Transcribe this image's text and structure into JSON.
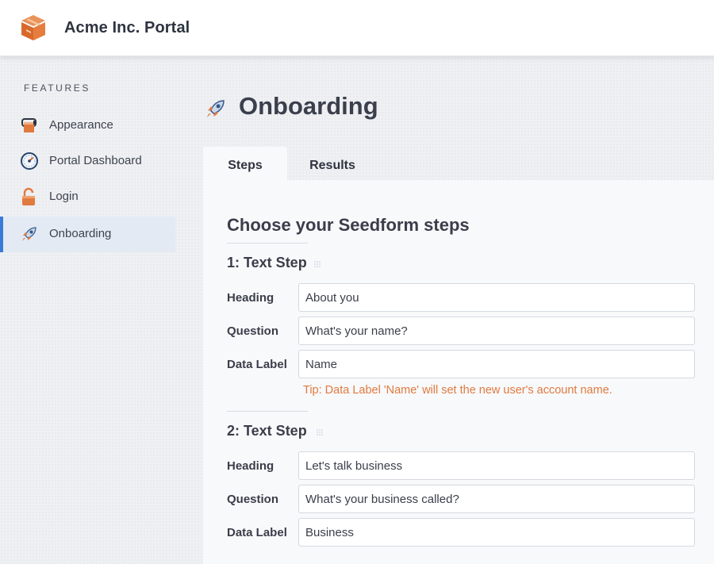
{
  "header": {
    "app_title": "Acme Inc. Portal",
    "logo_icon": "box-logo-icon",
    "brand_color": "#e07a3f"
  },
  "sidebar": {
    "heading": "FEATURES",
    "items": [
      {
        "label": "Appearance",
        "icon": "paint-roller-icon",
        "active": false
      },
      {
        "label": "Portal Dashboard",
        "icon": "dashboard-gauge-icon",
        "active": false
      },
      {
        "label": "Login",
        "icon": "unlocked-padlock-icon",
        "active": false
      },
      {
        "label": "Onboarding",
        "icon": "rocket-icon",
        "active": true
      }
    ],
    "active_color": "#3a7bd5"
  },
  "page": {
    "title": "Onboarding",
    "title_icon": "rocket-icon"
  },
  "tabs": [
    {
      "label": "Steps",
      "active": true
    },
    {
      "label": "Results",
      "active": false
    }
  ],
  "content": {
    "section_title": "Choose your Seedform steps",
    "steps": [
      {
        "title": "1: Text Step",
        "fields": [
          {
            "label": "Heading",
            "value": "About you"
          },
          {
            "label": "Question",
            "value": "What's your name?"
          },
          {
            "label": "Data Label",
            "value": "Name"
          }
        ],
        "tip": "Tip: Data Label 'Name' will set the new user's account name."
      },
      {
        "title": "2: Text Step",
        "fields": [
          {
            "label": "Heading",
            "value": "Let's talk business"
          },
          {
            "label": "Question",
            "value": "What's your business called?"
          },
          {
            "label": "Data Label",
            "value": "Business"
          }
        ]
      }
    ],
    "tip_color": "#e07a3f"
  }
}
